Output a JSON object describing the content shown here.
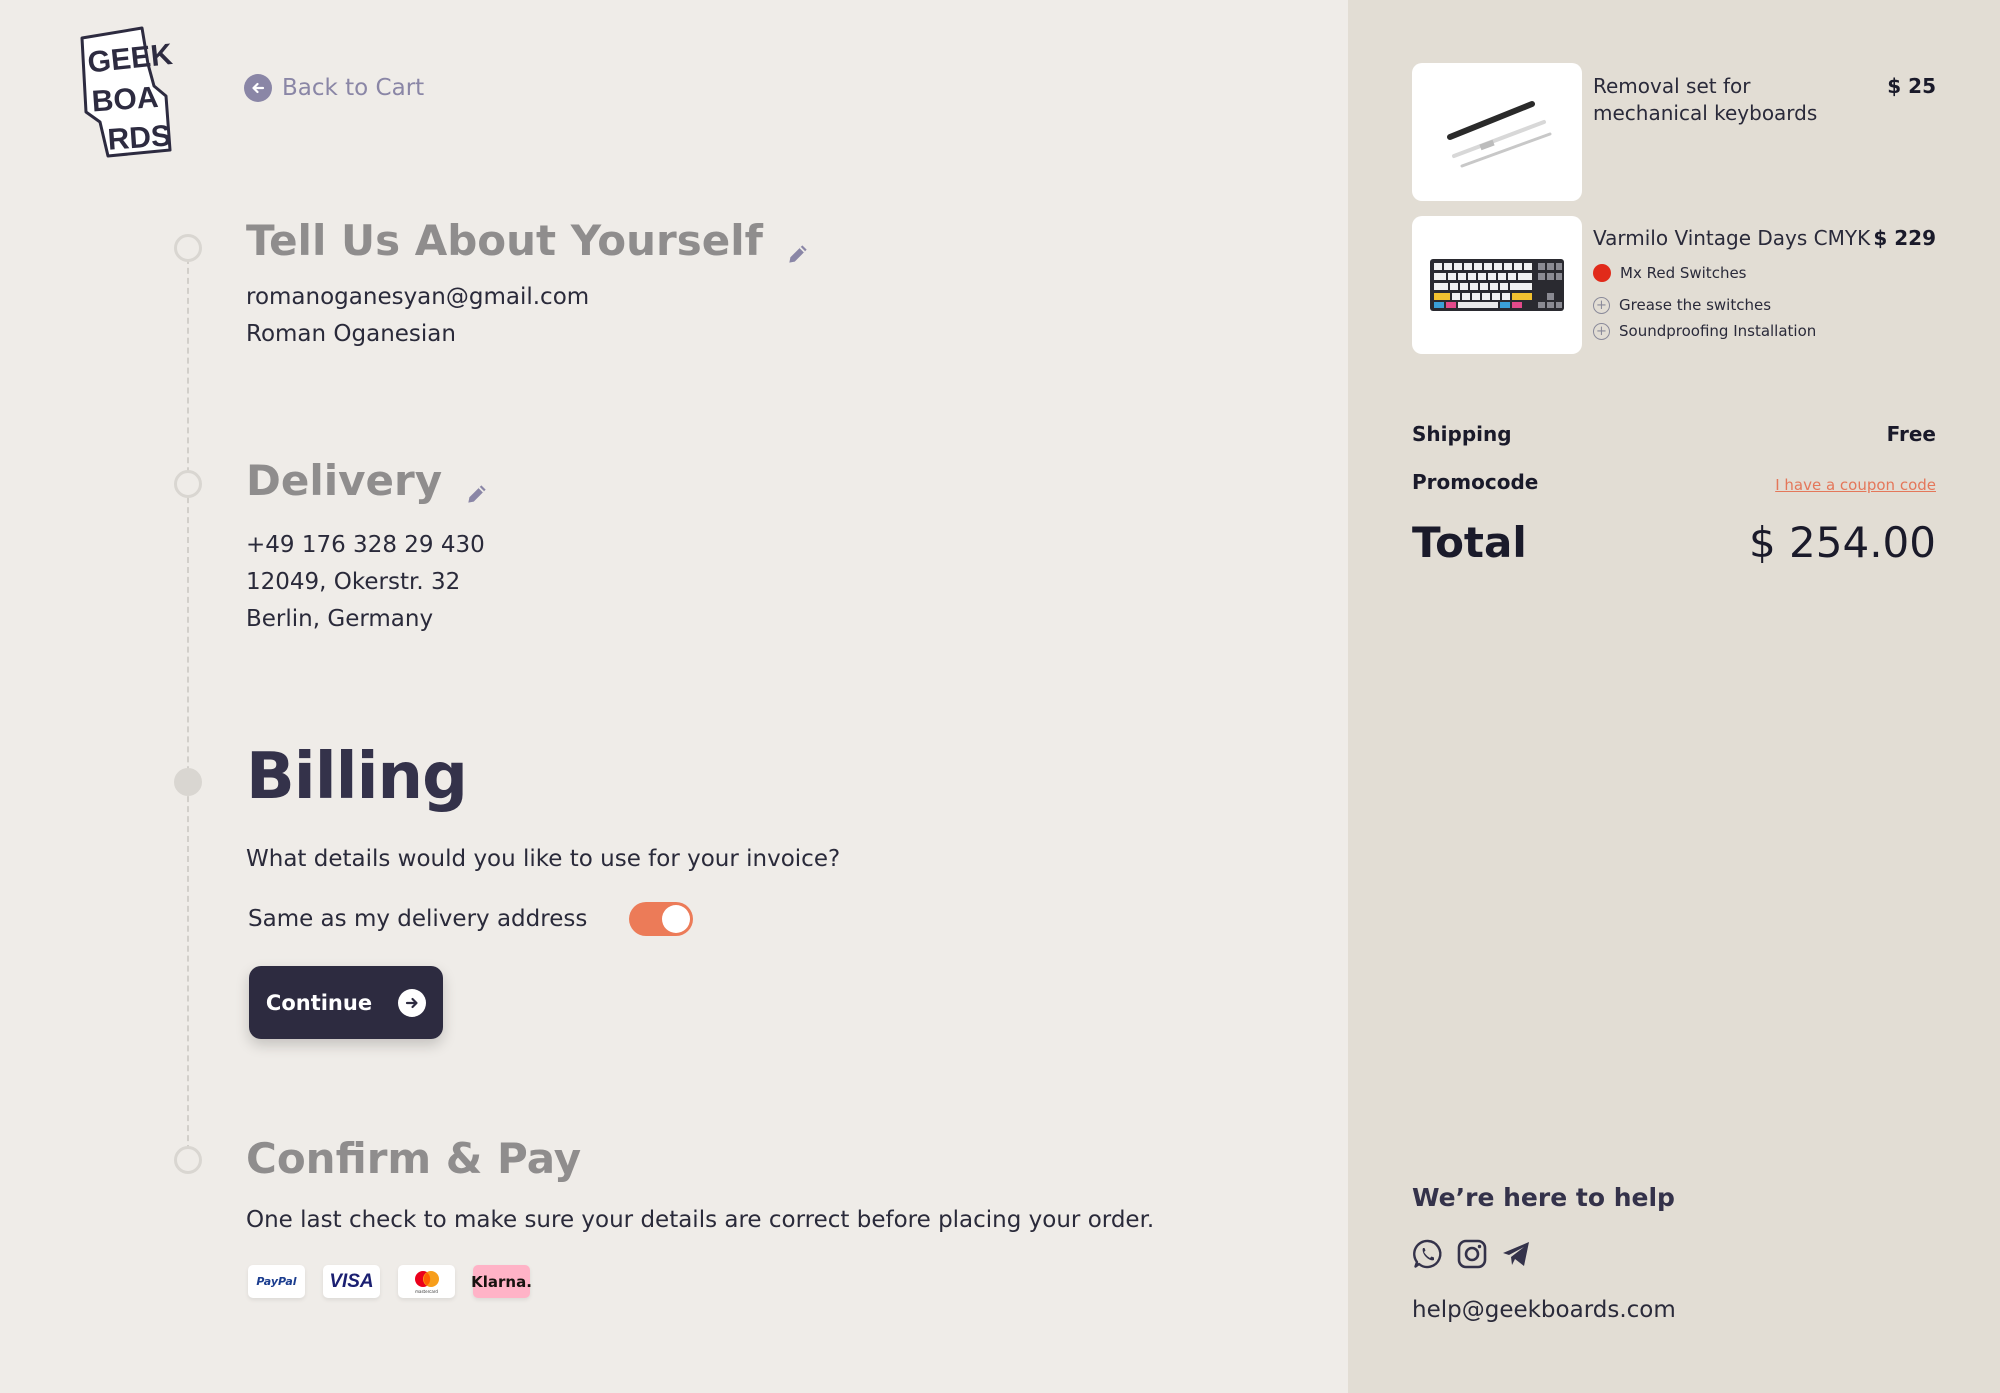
{
  "logo": {
    "line1": "GEEK",
    "line2": "BOA",
    "line3": "RDS"
  },
  "back": {
    "label": "Back to Cart"
  },
  "steps": {
    "about": {
      "title": "Tell Us About Yourself",
      "email": "romanoganesyan@gmail.com",
      "name": "Roman Oganesian"
    },
    "delivery": {
      "title": "Delivery",
      "phone": "+49 176 328 29 430",
      "address": "12049, Okerstr. 32",
      "city": "Berlin, Germany"
    },
    "billing": {
      "title": "Billing",
      "question": "What details would you like to use for your invoice?",
      "toggle_label": "Same as my delivery address",
      "toggle_on": true,
      "continue_label": "Continue"
    },
    "confirm": {
      "title": "Confirm & Pay",
      "text": "One last check to make sure your details are correct before placing your order."
    }
  },
  "payment_methods": [
    "PayPal",
    "VISA",
    "mastercard",
    "Klarna."
  ],
  "cart": {
    "items": [
      {
        "name": "Removal set for mechanical keyboards",
        "price": "$ 25"
      },
      {
        "name": "Varmilo Vintage Days CMYK",
        "price": "$ 229",
        "options": [
          "Mx Red Switches",
          "Grease the switches",
          "Soundproofing Installation"
        ]
      }
    ],
    "shipping_label": "Shipping",
    "shipping_value": "Free",
    "promo_label": "Promocode",
    "promo_link": "I have a coupon code",
    "total_label": "Total",
    "total_value": "$ 254.00"
  },
  "help": {
    "title": "We’re here to help",
    "email": "help@geekboards.com",
    "socials": [
      "whatsapp-icon",
      "instagram-icon",
      "telegram-icon"
    ]
  },
  "colors": {
    "accent": "#ec7b58",
    "dark": "#2d2b40",
    "link": "#8a86a6",
    "right_bg": "#e2ddd4",
    "left_bg": "#efece8"
  }
}
